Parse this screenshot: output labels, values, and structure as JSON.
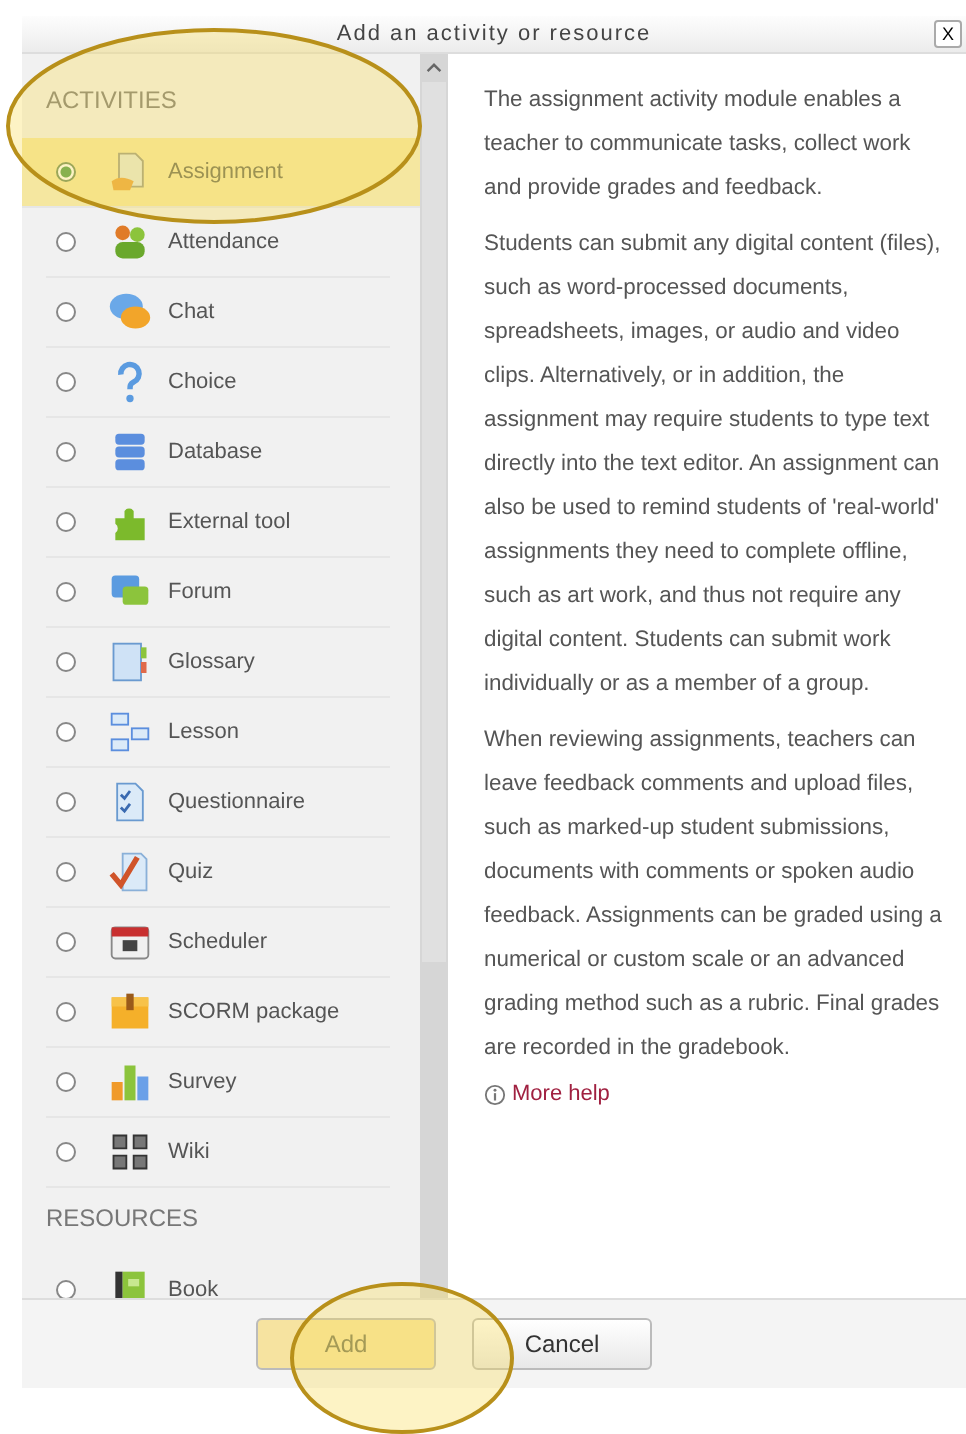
{
  "dialog": {
    "title": "Add an activity or resource",
    "close": "X"
  },
  "sections": [
    {
      "heading": "ACTIVITIES",
      "items": [
        {
          "label": "Assignment",
          "kind": "assignment",
          "selected": true
        },
        {
          "label": "Attendance",
          "kind": "attendance",
          "selected": false
        },
        {
          "label": "Chat",
          "kind": "chat",
          "selected": false
        },
        {
          "label": "Choice",
          "kind": "choice",
          "selected": false
        },
        {
          "label": "Database",
          "kind": "database",
          "selected": false
        },
        {
          "label": "External tool",
          "kind": "tool",
          "selected": false
        },
        {
          "label": "Forum",
          "kind": "forum",
          "selected": false
        },
        {
          "label": "Glossary",
          "kind": "glossary",
          "selected": false
        },
        {
          "label": "Lesson",
          "kind": "lesson",
          "selected": false
        },
        {
          "label": "Questionnaire",
          "kind": "questionnaire",
          "selected": false
        },
        {
          "label": "Quiz",
          "kind": "quiz",
          "selected": false
        },
        {
          "label": "Scheduler",
          "kind": "scheduler",
          "selected": false
        },
        {
          "label": "SCORM package",
          "kind": "scorm",
          "selected": false
        },
        {
          "label": "Survey",
          "kind": "survey",
          "selected": false
        },
        {
          "label": "Wiki",
          "kind": "wiki",
          "selected": false
        }
      ]
    },
    {
      "heading": "RESOURCES",
      "items": [
        {
          "label": "Book",
          "kind": "book",
          "selected": false
        }
      ]
    }
  ],
  "description": [
    "The assignment activity module enables a teacher to communicate tasks, collect work and provide grades and feedback.",
    "Students can submit any digital content (files), such as word-processed documents, spreadsheets, images, or audio and video clips. Alternatively, or in addition, the assignment may require students to type text directly into the text editor. An assignment can also be used to remind students of 'real-world' assignments they need to complete offline, such as art work, and thus not require any digital content. Students can submit work individually or as a member of a group.",
    "When reviewing assignments, teachers can leave feedback comments and upload files, such as marked-up student submissions, documents with comments or spoken audio feedback. Assignments can be graded using a numerical or custom scale or an advanced grading method such as a rubric. Final grades are recorded in the gradebook."
  ],
  "help_link": "More help",
  "buttons": [
    {
      "label": "Add",
      "kind": "primary"
    },
    {
      "label": "Cancel",
      "kind": "secondary"
    }
  ]
}
